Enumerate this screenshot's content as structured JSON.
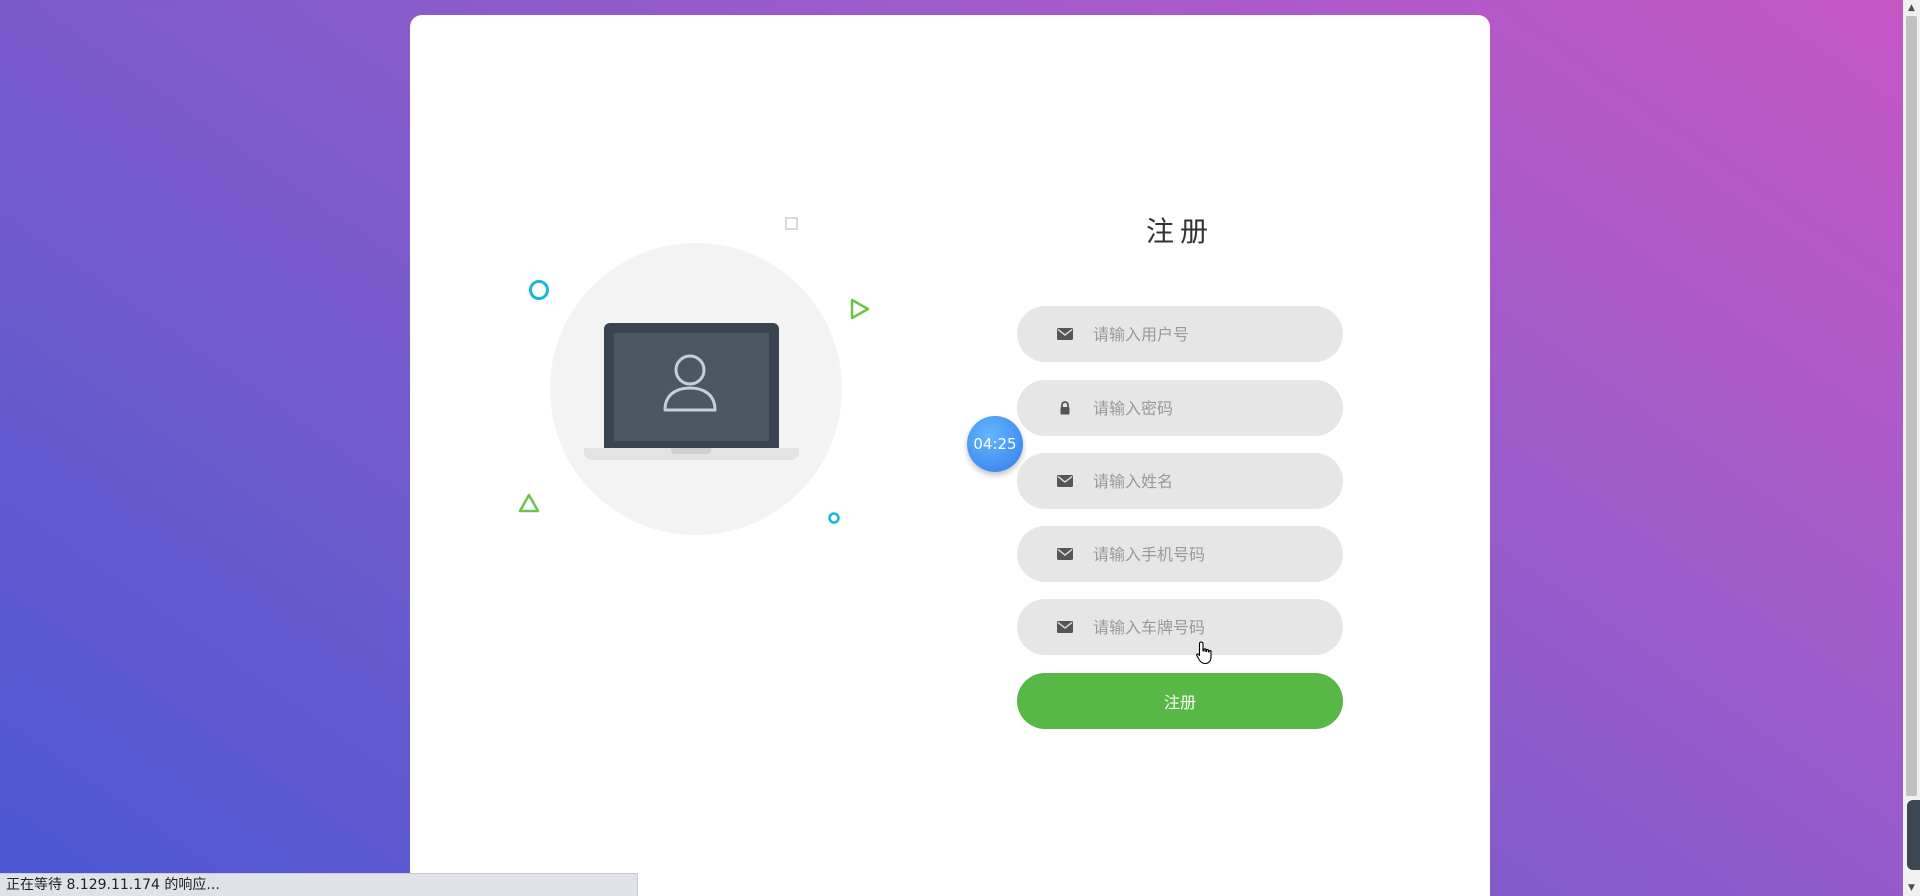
{
  "register": {
    "title": "注册",
    "submit_label": "注册",
    "fields": [
      {
        "icon": "envelope-icon",
        "placeholder": "请输入用户号",
        "value": ""
      },
      {
        "icon": "lock-icon",
        "placeholder": "请输入密码",
        "value": ""
      },
      {
        "icon": "envelope-icon",
        "placeholder": "请输入姓名",
        "value": ""
      },
      {
        "icon": "envelope-icon",
        "placeholder": "请输入手机号码",
        "value": ""
      },
      {
        "icon": "envelope-icon",
        "placeholder": "请输入车牌号码",
        "value": ""
      }
    ]
  },
  "timer": {
    "label": "04:25"
  },
  "status_bar": {
    "text": "正在等待 8.129.11.174 的响应..."
  },
  "colors": {
    "submit": "#57b846",
    "field_bg": "#e6e6e6",
    "accent_cyan": "#1ab7d6",
    "accent_green": "#6cc24a",
    "timer": "#3f8ff0"
  }
}
